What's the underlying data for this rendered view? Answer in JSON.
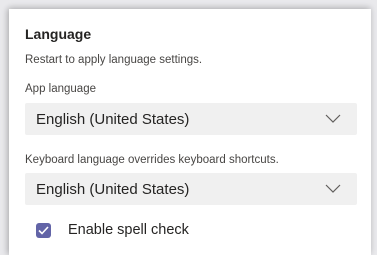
{
  "section": {
    "title": "Language",
    "subtitle": "Restart to apply language settings."
  },
  "app_language": {
    "label": "App language",
    "selected": "English (United States)"
  },
  "keyboard_language": {
    "label": "Keyboard language overrides keyboard shortcuts.",
    "selected": "English (United States)"
  },
  "spell_check": {
    "label": "Enable spell check",
    "checked": true
  },
  "colors": {
    "accent": "#6264a7",
    "select_bg": "#f0f0f0",
    "text_primary": "#252423",
    "text_secondary": "#484644"
  },
  "icons": {
    "dropdown": "chevron-down-icon",
    "check": "checkmark-icon"
  }
}
